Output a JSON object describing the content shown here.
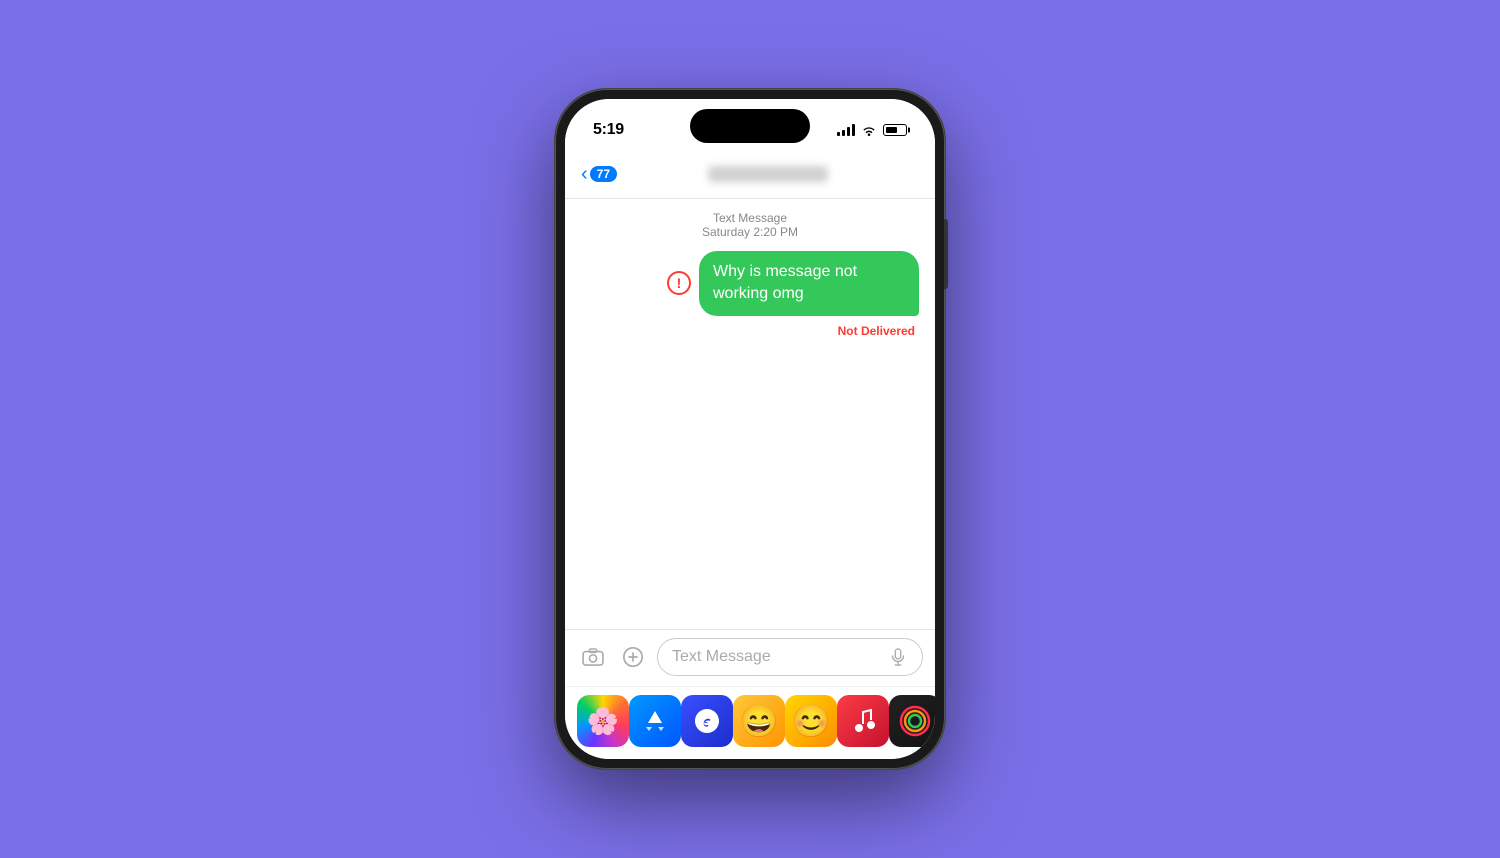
{
  "background_color": "#7B6FE8",
  "status_bar": {
    "time": "5:19",
    "battery_percent": "61"
  },
  "nav": {
    "back_count": "77",
    "contact_name": ""
  },
  "messages": {
    "timestamp_type": "Text Message",
    "timestamp_date": "Saturday 2:20 PM",
    "sent_message": "Why is message not working omg",
    "delivery_status": "Not Delivered"
  },
  "input": {
    "placeholder": "Text Message"
  },
  "dock": {
    "icons": [
      {
        "name": "Photos",
        "type": "photos"
      },
      {
        "name": "App Store",
        "type": "appstore"
      },
      {
        "name": "Shazam",
        "type": "shazam"
      },
      {
        "name": "Bitmoji",
        "type": "bitmoji"
      },
      {
        "name": "Bitmoji 2",
        "type": "bitmoji2"
      },
      {
        "name": "Music",
        "type": "music"
      },
      {
        "name": "Fitness",
        "type": "fitness"
      }
    ]
  }
}
